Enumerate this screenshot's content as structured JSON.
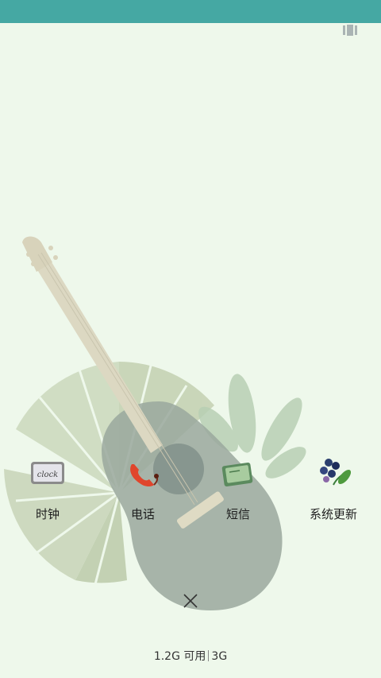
{
  "apps": [
    {
      "label": "时钟",
      "icon": "clock-icon",
      "icon_text": "clock"
    },
    {
      "label": "电话",
      "icon": "phone-icon"
    },
    {
      "label": "短信",
      "icon": "message-icon"
    },
    {
      "label": "系统更新",
      "icon": "system-update-icon"
    }
  ],
  "memory": {
    "available": "1.2G 可用",
    "total": "3G"
  },
  "colors": {
    "status_bar": "#45a8a3",
    "background": "#eef8eb"
  }
}
